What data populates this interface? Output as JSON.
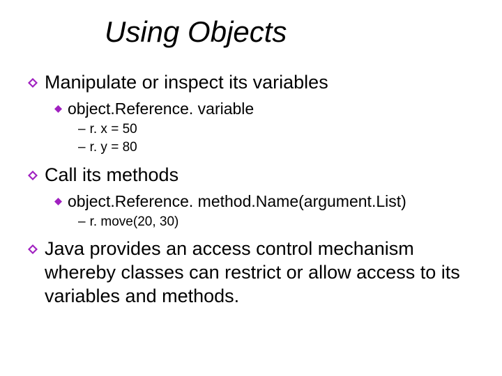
{
  "title": "Using Objects",
  "items": [
    {
      "text": "Manipulate or inspect its variables",
      "sub": [
        {
          "text": "object.Reference. variable",
          "sub": [
            {
              "text": "r. x = 50"
            },
            {
              "text": "r. y = 80"
            }
          ]
        }
      ]
    },
    {
      "text": "Call its methods",
      "sub": [
        {
          "text": "object.Reference. method.Name(argument.List)",
          "sub": [
            {
              "text": "r. move(20, 30)"
            }
          ]
        }
      ]
    },
    {
      "text": "Java provides an access control mechanism whereby classes can restrict or allow access to its variables and methods."
    }
  ],
  "colors": {
    "bullet": "#a020c0"
  }
}
